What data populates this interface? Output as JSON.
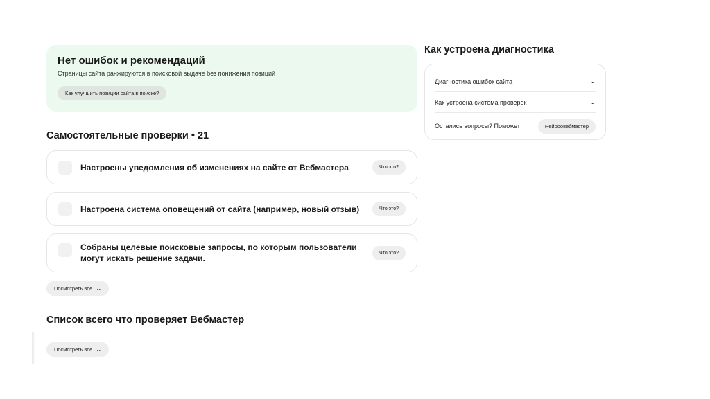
{
  "status_card": {
    "title": "Нет ошибок и рекомендаций",
    "subtitle": "Страницы сайта ранжируются в поисковой выдаче без понижения позиций",
    "chip_label": "Как улучшить позиции сайта в поиске?",
    "background_color": "#ecf9ee"
  },
  "self_checks": {
    "title": "Самостоятельные проверки • 21",
    "items": [
      {
        "text": "Настроены уведомления об изменениях на сайте от Вебмастера",
        "button": "Что это?"
      },
      {
        "text": "Настроена система оповещений от сайта (например, новый отзыв)",
        "button": "Что это?"
      },
      {
        "text": "Собраны целевые поисковые запросы, по которым пользователи могут искать решение задачи.",
        "button": "Что это?"
      }
    ],
    "see_all_label": "Посмотреть все",
    "see_all_icon": "chevron-down-icon"
  },
  "webmaster_list": {
    "title": "Список всего что проверяет Вебмастер",
    "see_all_label": "Посмотреть все",
    "see_all_icon": "chevron-down-icon"
  },
  "diagnostics": {
    "title": "Как устроена диагностика",
    "accordion": [
      {
        "label": "Диагностика ошибок сайта",
        "icon": "chevron-down-icon"
      },
      {
        "label": "Как устроена система проверок",
        "icon": "chevron-down-icon"
      }
    ],
    "help_text": "Остались вопросы? Поможет",
    "help_button": "Нейроовебмастер"
  }
}
